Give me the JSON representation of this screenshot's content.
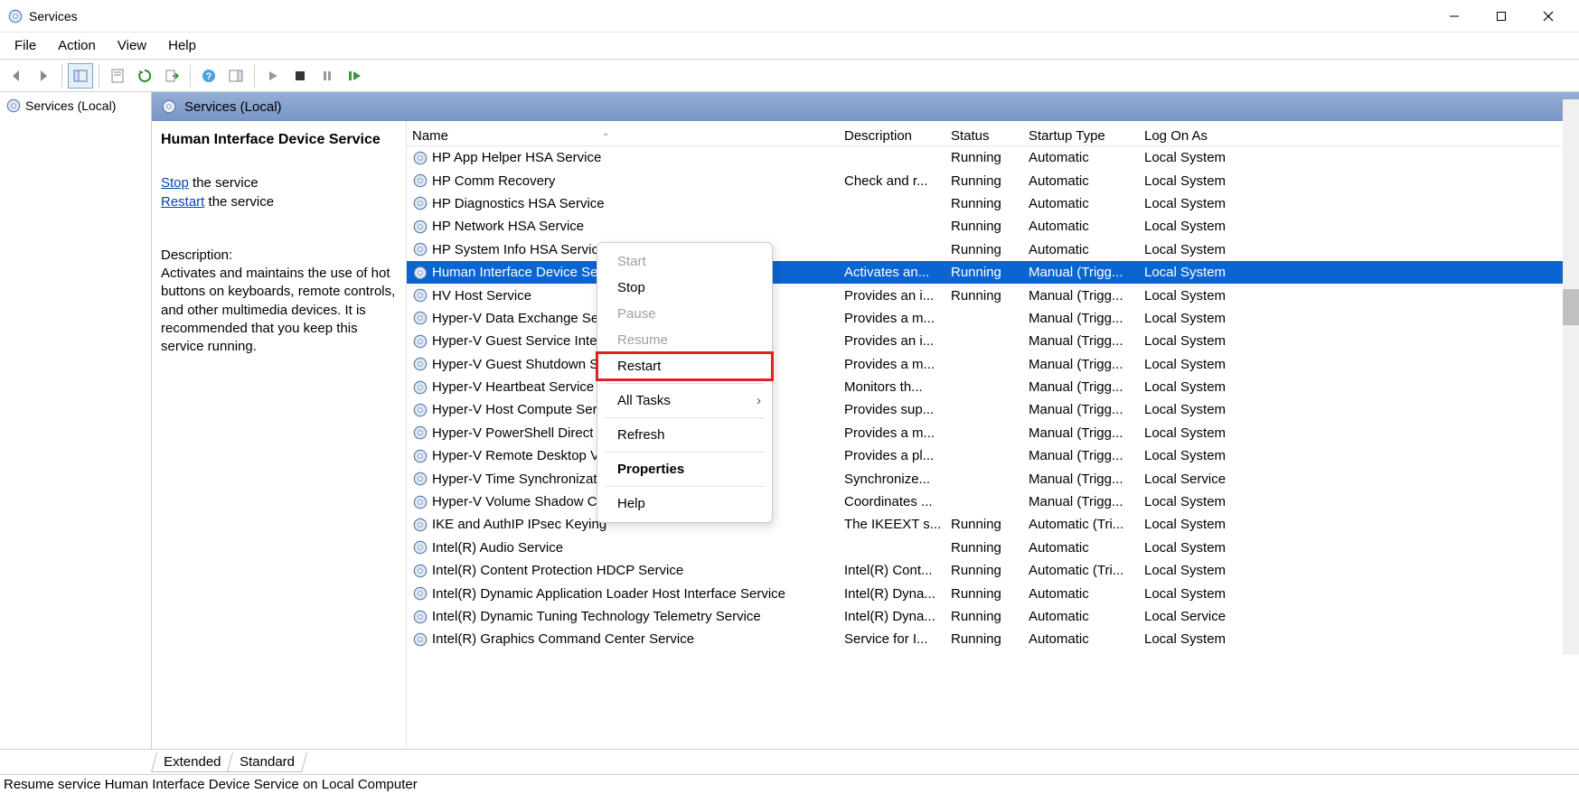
{
  "window": {
    "title": "Services"
  },
  "menubar": [
    "File",
    "Action",
    "View",
    "Help"
  ],
  "tree": {
    "node": "Services (Local)"
  },
  "contentHeader": "Services (Local)",
  "detail": {
    "serviceName": "Human Interface Device Service",
    "stopLink": "Stop",
    "stopSuffix": " the service",
    "restartLink": "Restart",
    "restartSuffix": " the service",
    "descLabel": "Description:",
    "descText": "Activates and maintains the use of hot buttons on keyboards, remote controls, and other multimedia devices. It is recommended that you keep this service running."
  },
  "columns": {
    "name": "Name",
    "desc": "Description",
    "status": "Status",
    "startup": "Startup Type",
    "logon": "Log On As"
  },
  "rows": [
    {
      "name": "HP App Helper HSA Service",
      "desc": "",
      "status": "Running",
      "startup": "Automatic",
      "logon": "Local System"
    },
    {
      "name": "HP Comm Recovery",
      "desc": "Check and r...",
      "status": "Running",
      "startup": "Automatic",
      "logon": "Local System"
    },
    {
      "name": "HP Diagnostics HSA Service",
      "desc": "",
      "status": "Running",
      "startup": "Automatic",
      "logon": "Local System"
    },
    {
      "name": "HP Network HSA Service",
      "desc": "",
      "status": "Running",
      "startup": "Automatic",
      "logon": "Local System"
    },
    {
      "name": "HP System Info HSA Service",
      "desc": "",
      "status": "Running",
      "startup": "Automatic",
      "logon": "Local System"
    },
    {
      "name": "Human Interface Device Service",
      "desc": "Activates an...",
      "status": "Running",
      "startup": "Manual (Trigg...",
      "logon": "Local System",
      "selected": true,
      "truncatedName": "Human Interface Device Se"
    },
    {
      "name": "HV Host Service",
      "desc": "Provides an i...",
      "status": "Running",
      "startup": "Manual (Trigg...",
      "logon": "Local System"
    },
    {
      "name": "Hyper-V Data Exchange Service",
      "desc": "Provides a m...",
      "status": "",
      "startup": "Manual (Trigg...",
      "logon": "Local System",
      "truncatedName": "Hyper-V Data Exchange Ser"
    },
    {
      "name": "Hyper-V Guest Service Interface",
      "desc": "Provides an i...",
      "status": "",
      "startup": "Manual (Trigg...",
      "logon": "Local System",
      "truncatedName": "Hyper-V Guest Service Inte"
    },
    {
      "name": "Hyper-V Guest Shutdown Service",
      "desc": "Provides a m...",
      "status": "",
      "startup": "Manual (Trigg...",
      "logon": "Local System",
      "truncatedName": "Hyper-V Guest Shutdown S"
    },
    {
      "name": "Hyper-V Heartbeat Service",
      "desc": "Monitors th...",
      "status": "",
      "startup": "Manual (Trigg...",
      "logon": "Local System"
    },
    {
      "name": "Hyper-V Host Compute Service",
      "desc": "Provides sup...",
      "status": "",
      "startup": "Manual (Trigg...",
      "logon": "Local System",
      "truncatedName": "Hyper-V Host Compute Ser"
    },
    {
      "name": "Hyper-V PowerShell Direct Service",
      "desc": "Provides a m...",
      "status": "",
      "startup": "Manual (Trigg...",
      "logon": "Local System",
      "truncatedName": "Hyper-V PowerShell Direct"
    },
    {
      "name": "Hyper-V Remote Desktop Virtualization",
      "desc": "Provides a pl...",
      "status": "",
      "startup": "Manual (Trigg...",
      "logon": "Local System",
      "truncatedName": "Hyper-V Remote Desktop V"
    },
    {
      "name": "Hyper-V Time Synchronization Service",
      "desc": "Synchronize...",
      "status": "",
      "startup": "Manual (Trigg...",
      "logon": "Local Service",
      "truncatedName": "Hyper-V Time Synchronizat"
    },
    {
      "name": "Hyper-V Volume Shadow Copy Requestor",
      "desc": "Coordinates ...",
      "status": "",
      "startup": "Manual (Trigg...",
      "logon": "Local System",
      "truncatedName": "Hyper-V Volume Shadow C"
    },
    {
      "name": "IKE and AuthIP IPsec Keying Modules",
      "desc": "The IKEEXT s...",
      "status": "Running",
      "startup": "Automatic (Tri...",
      "logon": "Local System",
      "truncatedName": "IKE and AuthIP IPsec Keying"
    },
    {
      "name": "Intel(R) Audio Service",
      "desc": "",
      "status": "Running",
      "startup": "Automatic",
      "logon": "Local System"
    },
    {
      "name": "Intel(R) Content Protection HDCP Service",
      "desc": "Intel(R) Cont...",
      "status": "Running",
      "startup": "Automatic (Tri...",
      "logon": "Local System"
    },
    {
      "name": "Intel(R) Dynamic Application Loader Host Interface Service",
      "desc": "Intel(R) Dyna...",
      "status": "Running",
      "startup": "Automatic",
      "logon": "Local System"
    },
    {
      "name": "Intel(R) Dynamic Tuning Technology Telemetry Service",
      "desc": "Intel(R) Dyna...",
      "status": "Running",
      "startup": "Automatic",
      "logon": "Local Service"
    },
    {
      "name": "Intel(R) Graphics Command Center Service",
      "desc": "Service for I...",
      "status": "Running",
      "startup": "Automatic",
      "logon": "Local System"
    }
  ],
  "contextMenu": [
    {
      "label": "Start",
      "disabled": true
    },
    {
      "label": "Stop"
    },
    {
      "label": "Pause",
      "disabled": true
    },
    {
      "label": "Resume",
      "disabled": true
    },
    {
      "label": "Restart",
      "highlight": true
    },
    {
      "sep": true
    },
    {
      "label": "All Tasks",
      "submenu": true
    },
    {
      "sep": true
    },
    {
      "label": "Refresh"
    },
    {
      "sep": true
    },
    {
      "label": "Properties",
      "bold": true
    },
    {
      "sep": true
    },
    {
      "label": "Help"
    }
  ],
  "tabs": [
    "Extended",
    "Standard"
  ],
  "statusbar": "Resume service Human Interface Device Service on Local Computer"
}
